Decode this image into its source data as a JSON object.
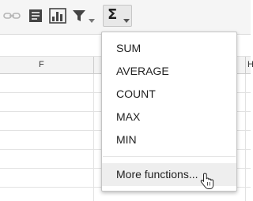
{
  "toolbar": {
    "icons": [
      "link-icon",
      "comment-icon",
      "chart-icon",
      "filter-icon",
      "chevron-down-icon"
    ],
    "functions_button": {
      "glyph": "Σ",
      "icon": "sigma-icon"
    }
  },
  "sheet": {
    "column_headers": [
      "F",
      "H"
    ]
  },
  "functions_menu": {
    "items": [
      "SUM",
      "AVERAGE",
      "COUNT",
      "MAX",
      "MIN"
    ],
    "more_label": "More functions..."
  },
  "colors": {
    "toolbar_bg": "#f5f5f5",
    "menu_hover": "#eeeeee",
    "grid_line": "#e2e2e2"
  }
}
